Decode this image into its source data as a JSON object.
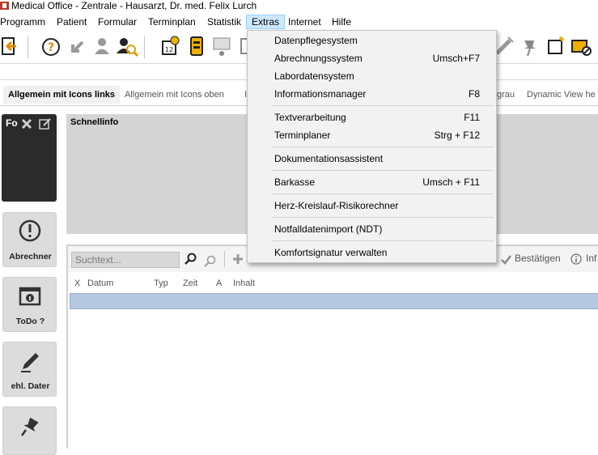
{
  "window": {
    "title": "Medical Office - Zentrale - Hausarzt, Dr. med. Felix Lurch"
  },
  "menubar": {
    "items": [
      {
        "label": "Programm"
      },
      {
        "label": "Patient"
      },
      {
        "label": "Formular"
      },
      {
        "label": "Terminplan"
      },
      {
        "label": "Statistik"
      },
      {
        "label": "Extras"
      },
      {
        "label": "Internet"
      },
      {
        "label": "Hilfe"
      }
    ],
    "active": "Extras"
  },
  "extras_menu": {
    "items": [
      {
        "label": "Datenpflegesystem",
        "shortcut": ""
      },
      {
        "label": "Abrechnungssystem",
        "shortcut": "Umsch+F7"
      },
      {
        "label": "Labordatensystem",
        "shortcut": ""
      },
      {
        "label": "Informationsmanager",
        "shortcut": "F8"
      },
      {
        "label": "Textverarbeitung",
        "shortcut": "F11"
      },
      {
        "label": "Terminplaner",
        "shortcut": "Strg + F12"
      },
      {
        "label": "Dokumentationsassistent",
        "shortcut": ""
      },
      {
        "label": "Barkasse",
        "shortcut": "Umsch + F11"
      },
      {
        "label": "Herz-Kreislauf-Risikorechner",
        "shortcut": ""
      },
      {
        "label": "Notfalldatenimport (NDT)",
        "shortcut": ""
      },
      {
        "label": "Komfortsignatur verwalten",
        "shortcut": ""
      }
    ]
  },
  "tabs": [
    {
      "label": "Allgemein mit Icons links",
      "selected": true
    },
    {
      "label": "Allgemein mit Icons oben",
      "selected": false
    },
    {
      "label": "I",
      "selected": false
    },
    {
      "label": "grau",
      "selected": false
    },
    {
      "label": "Dynamic View he",
      "selected": false
    }
  ],
  "fo_tile": {
    "label": "Fo"
  },
  "schnellinfo": {
    "label": "Schnellinfo"
  },
  "side_tiles": [
    {
      "label": "Abrechner",
      "icon": "exclamation-circle-icon"
    },
    {
      "label": "ToDo ?",
      "icon": "info-box-icon"
    },
    {
      "label": "ehl. Dater",
      "icon": "pen-icon"
    },
    {
      "label": "",
      "icon": "pin-icon"
    }
  ],
  "search": {
    "placeholder": "Suchtext..."
  },
  "list_actions": {
    "confirm": "Bestätigen",
    "info": "Inf"
  },
  "columns": [
    "X",
    "Datum",
    "Typ",
    "Zeit",
    "A",
    "Inhalt"
  ],
  "colors": {
    "menu_highlight": "#cce8ff",
    "selected_row": "#b6c8e0",
    "tile_dark": "#2b2b2b",
    "panel_gray": "#d4d4d4"
  }
}
